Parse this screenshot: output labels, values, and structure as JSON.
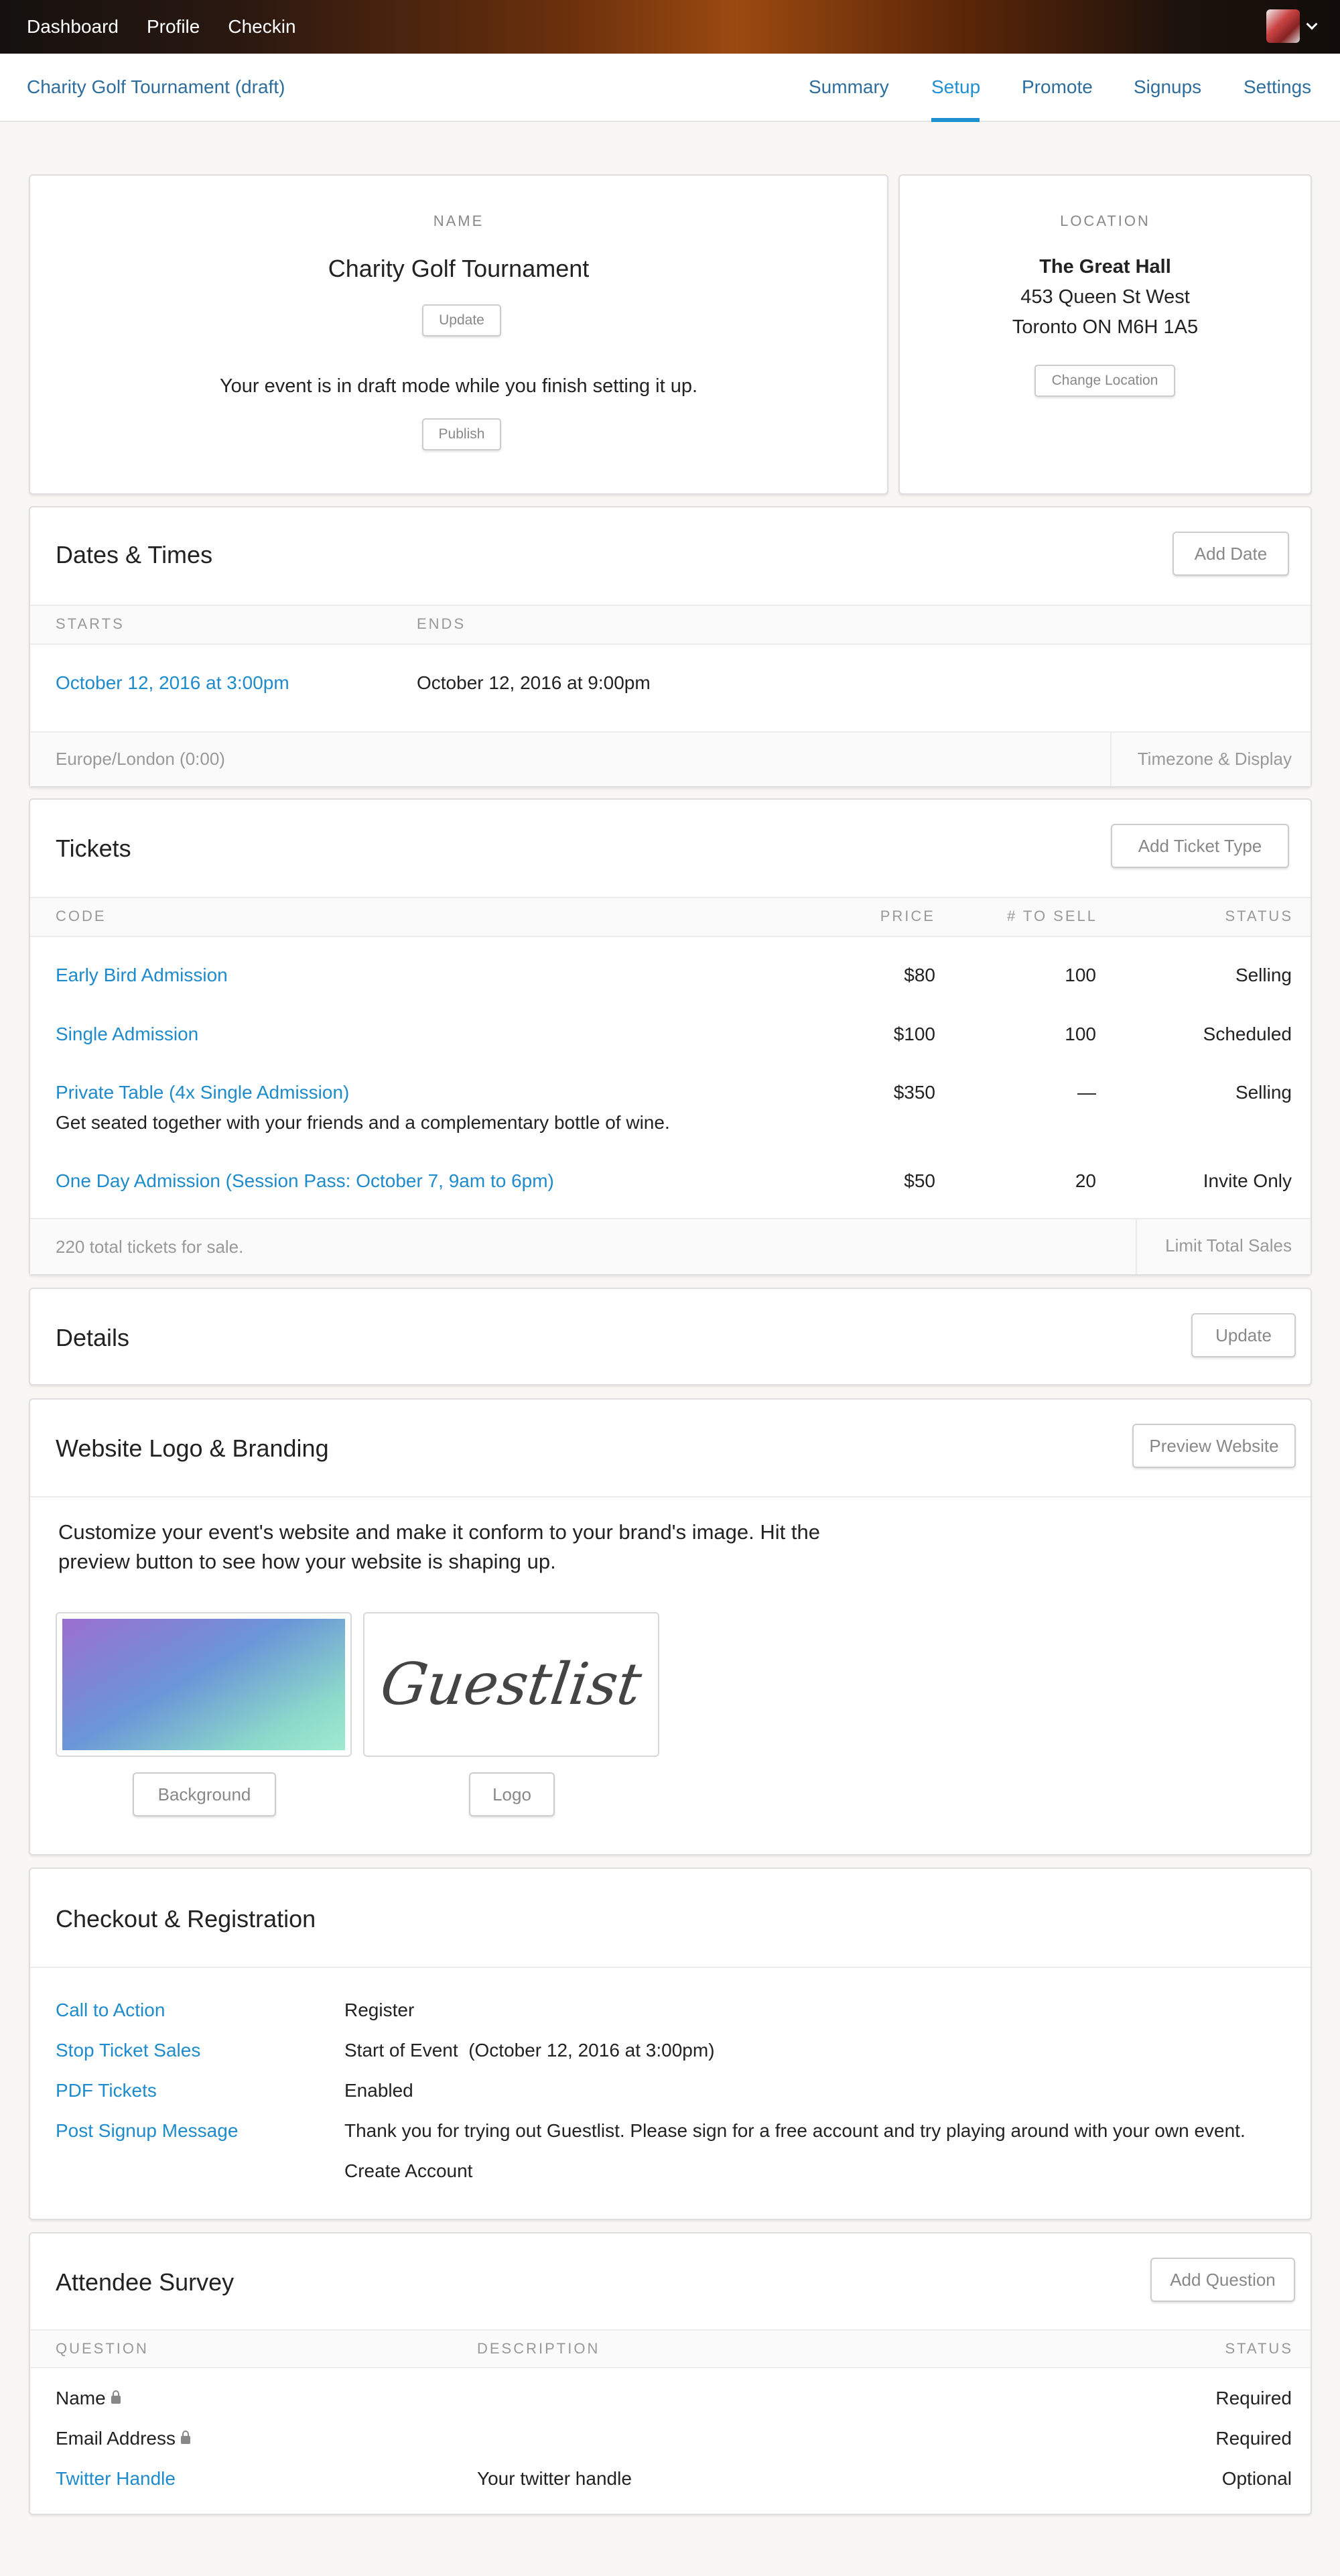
{
  "topnav": {
    "items": [
      "Dashboard",
      "Profile",
      "Checkin"
    ]
  },
  "subnav": {
    "event_title": "Charity Golf Tournament (draft)",
    "tabs": [
      "Summary",
      "Setup",
      "Promote",
      "Signups",
      "Settings"
    ],
    "active_tab": "Setup"
  },
  "name_card": {
    "caption": "NAME",
    "name": "Charity Golf Tournament",
    "update_label": "Update",
    "draft_message": "Your event is in draft mode while you finish setting it up.",
    "publish_label": "Publish"
  },
  "location_card": {
    "caption": "LOCATION",
    "venue": "The Great Hall",
    "address1": "453 Queen St West",
    "address2": "Toronto ON M6H 1A5",
    "change_label": "Change Location"
  },
  "dates": {
    "title": "Dates & Times",
    "add_label": "Add Date",
    "col_starts": "STARTS",
    "col_ends": "ENDS",
    "start": "October 12, 2016 at 3:00pm",
    "end": "October 12, 2016 at 9:00pm",
    "timezone": "Europe/London (0:00)",
    "timezone_link": "Timezone & Display"
  },
  "tickets": {
    "title": "Tickets",
    "add_label": "Add Ticket Type",
    "columns": {
      "code": "CODE",
      "price": "PRICE",
      "to_sell": "# TO SELL",
      "status": "STATUS"
    },
    "rows": [
      {
        "name": "Early Bird Admission",
        "price": "$80",
        "qty": "100",
        "status": "Selling",
        "desc": ""
      },
      {
        "name": "Single Admission",
        "price": "$100",
        "qty": "100",
        "status": "Scheduled",
        "desc": ""
      },
      {
        "name": "Private Table (4x Single Admission)",
        "price": "$350",
        "qty": "—",
        "status": "Selling",
        "desc": "Get seated together with your friends and a complementary bottle of wine."
      },
      {
        "name": "One Day Admission (Session Pass: October 7, 9am to 6pm)",
        "price": "$50",
        "qty": "20",
        "status": "Invite Only",
        "desc": ""
      }
    ],
    "total": "220 total tickets for sale.",
    "limit_label": "Limit Total Sales"
  },
  "details": {
    "title": "Details",
    "update_label": "Update"
  },
  "branding": {
    "title": "Website Logo & Branding",
    "preview_label": "Preview Website",
    "description_line1": "Customize your event's website and make it conform to your brand's image. Hit the",
    "description_line2": "preview button to see how your website is shaping up.",
    "background_label": "Background",
    "logo_label": "Logo",
    "logo_text": "Guestlist"
  },
  "checkout": {
    "title": "Checkout & Registration",
    "rows": [
      {
        "label": "Call to Action",
        "value": "Register"
      },
      {
        "label": "Stop Ticket Sales",
        "value": "Start of Event  (October 12, 2016 at 3:00pm)"
      },
      {
        "label": "PDF Tickets",
        "value": "Enabled"
      },
      {
        "label": "Post Signup Message",
        "value": "Thank you for trying out Guestlist. Please sign for a free account and try playing around with your own event."
      }
    ],
    "extra_value": "Create Account"
  },
  "survey": {
    "title": "Attendee Survey",
    "add_label": "Add Question",
    "columns": {
      "question": "QUESTION",
      "description": "DESCRIPTION",
      "status": "STATUS"
    },
    "rows": [
      {
        "question": "Name",
        "description": "",
        "status": "Required",
        "locked": true
      },
      {
        "question": "Email Address",
        "description": "",
        "status": "Required",
        "locked": true
      },
      {
        "question": "Twitter Handle",
        "description": "Your twitter handle",
        "status": "Optional",
        "locked": false
      }
    ]
  },
  "colors": {
    "link": "#1e8bcd",
    "active_tab": "#1e90d2",
    "nav_text": "#2d6e9e"
  },
  "icons": {
    "lock": "lock-icon",
    "caret": "chevron-down-icon"
  }
}
